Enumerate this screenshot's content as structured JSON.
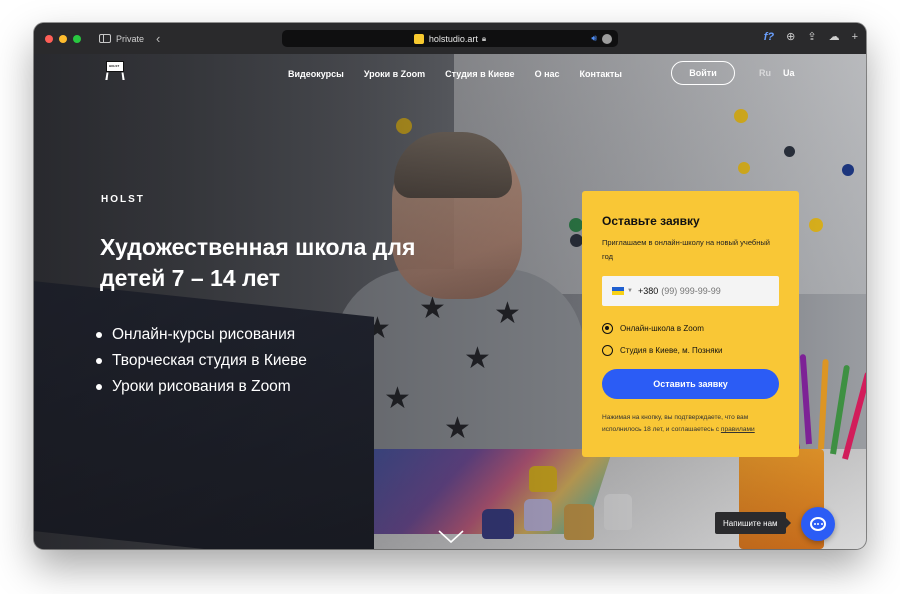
{
  "browser": {
    "mode_label": "Private",
    "url": "holstudio.art"
  },
  "nav": {
    "items": [
      "Видеокурсы",
      "Уроки в Zoom",
      "Студия в Киеве",
      "О нас",
      "Контакты"
    ],
    "login_label": "Войти",
    "languages": [
      "Ru",
      "Ua"
    ],
    "active_language": "Ua"
  },
  "logo": {
    "text": "HOLST"
  },
  "hero": {
    "brand": "HOLST",
    "title": "Художественная школа для детей 7 – 14 лет",
    "features": [
      "Онлайн-курсы рисования",
      "Творческая студия в Киеве",
      "Уроки рисования в Zoom"
    ]
  },
  "form": {
    "title": "Оставьте заявку",
    "subtitle": "Приглашаем в онлайн-школу на новый учебный год",
    "phone_prefix": "+380",
    "phone_placeholder": "(99) 999-99-99",
    "options": [
      "Онлайн-школа в Zoom",
      "Студия в Киеве, м. Позняки"
    ],
    "selected_option": "Онлайн-школа в Zoom",
    "submit_label": "Оставить заявку",
    "consent_text": "Нажимая на кнопку, вы подтверждаете, что вам исполнилось 18 лет, и соглашаетесь с",
    "consent_link": "правилами"
  },
  "chat": {
    "tooltip": "Напишите нам"
  },
  "colors": {
    "accent_yellow": "#f9c736",
    "button_blue": "#2b5cf5",
    "chrome_dark": "#2a2a2c"
  }
}
